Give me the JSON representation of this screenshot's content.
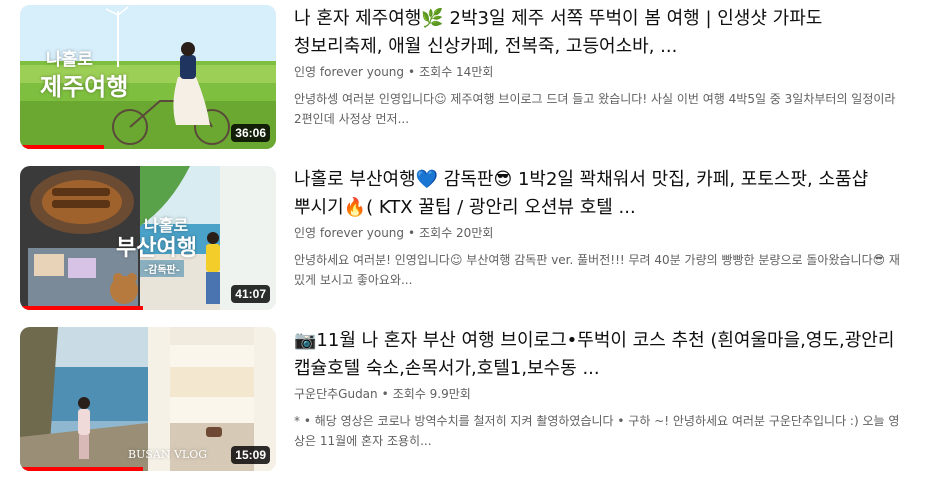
{
  "results": [
    {
      "title": "나 혼자 제주여행🌿 2박3일 제주 서쪽 뚜벅이 봄 여행 | 인생샷 가파도 청보리축제, 애월 신상카페, 전복죽, 고등어소바, ...",
      "channel": "인영 forever young",
      "separator": "•",
      "views": "조회수 14만회",
      "description": "안녕하셍 여러분 인영입니다☺ 제주여행 브이로그 드뎌 들고 왔습니다! 사실 이번 여행 4박5일 중 3일차부터의 일정이라 2편인데 사정상 먼저...",
      "duration": "36:06",
      "thumb_text_line1": "나홀로",
      "thumb_text_line2": "제주여행",
      "watched_fraction": 0.33
    },
    {
      "title": "나홀로 부산여행💙 감독판😎 1박2일 꽉채워서 맛집, 카페, 포토스팟, 소품샵 뿌시기🔥( KTX 꿀팁 / 광안리 오션뷰 호텔 ...",
      "channel": "인영 forever young",
      "separator": "•",
      "views": "조회수 20만회",
      "description": "안녕하세요 여러분! 인영입니다☺ 부산여행 감독판 ver. 풀버전!!! 무려 40분 가량의 빵빵한 분량으로 돌아왔습니다😎 재밌게 보시고 좋아요와...",
      "duration": "41:07",
      "thumb_text_line1": "나홀로",
      "thumb_text_line2": "부산여행",
      "thumb_tag": "-감독판-",
      "watched_fraction": 0.48
    },
    {
      "title": "📷11월 나 혼자 부산 여행 브이로그•뚜벅이 코스 추천 (흰여울마을,영도,광안리 캡슐호텔 숙소,손목서가,호텔1,보수동 ...",
      "channel": "구운단추Gudan",
      "separator": "•",
      "views": "조회수 9.9만회",
      "description": "* • 해당 영상은 코로나 방역수치를 철저히 지켜 촬영하였습니다 • 구하 ~! 안녕하세요 여러분 구운단추입니다 :) 오늘 영상은 11월에 혼자 조용히...",
      "duration": "15:09",
      "thumb_text_line1": "BUSAN VLOG",
      "watched_fraction": 0.48
    }
  ],
  "colors": {
    "progress": "#ff0000",
    "meta_text": "#606060",
    "title_text": "#0f0f0f"
  }
}
